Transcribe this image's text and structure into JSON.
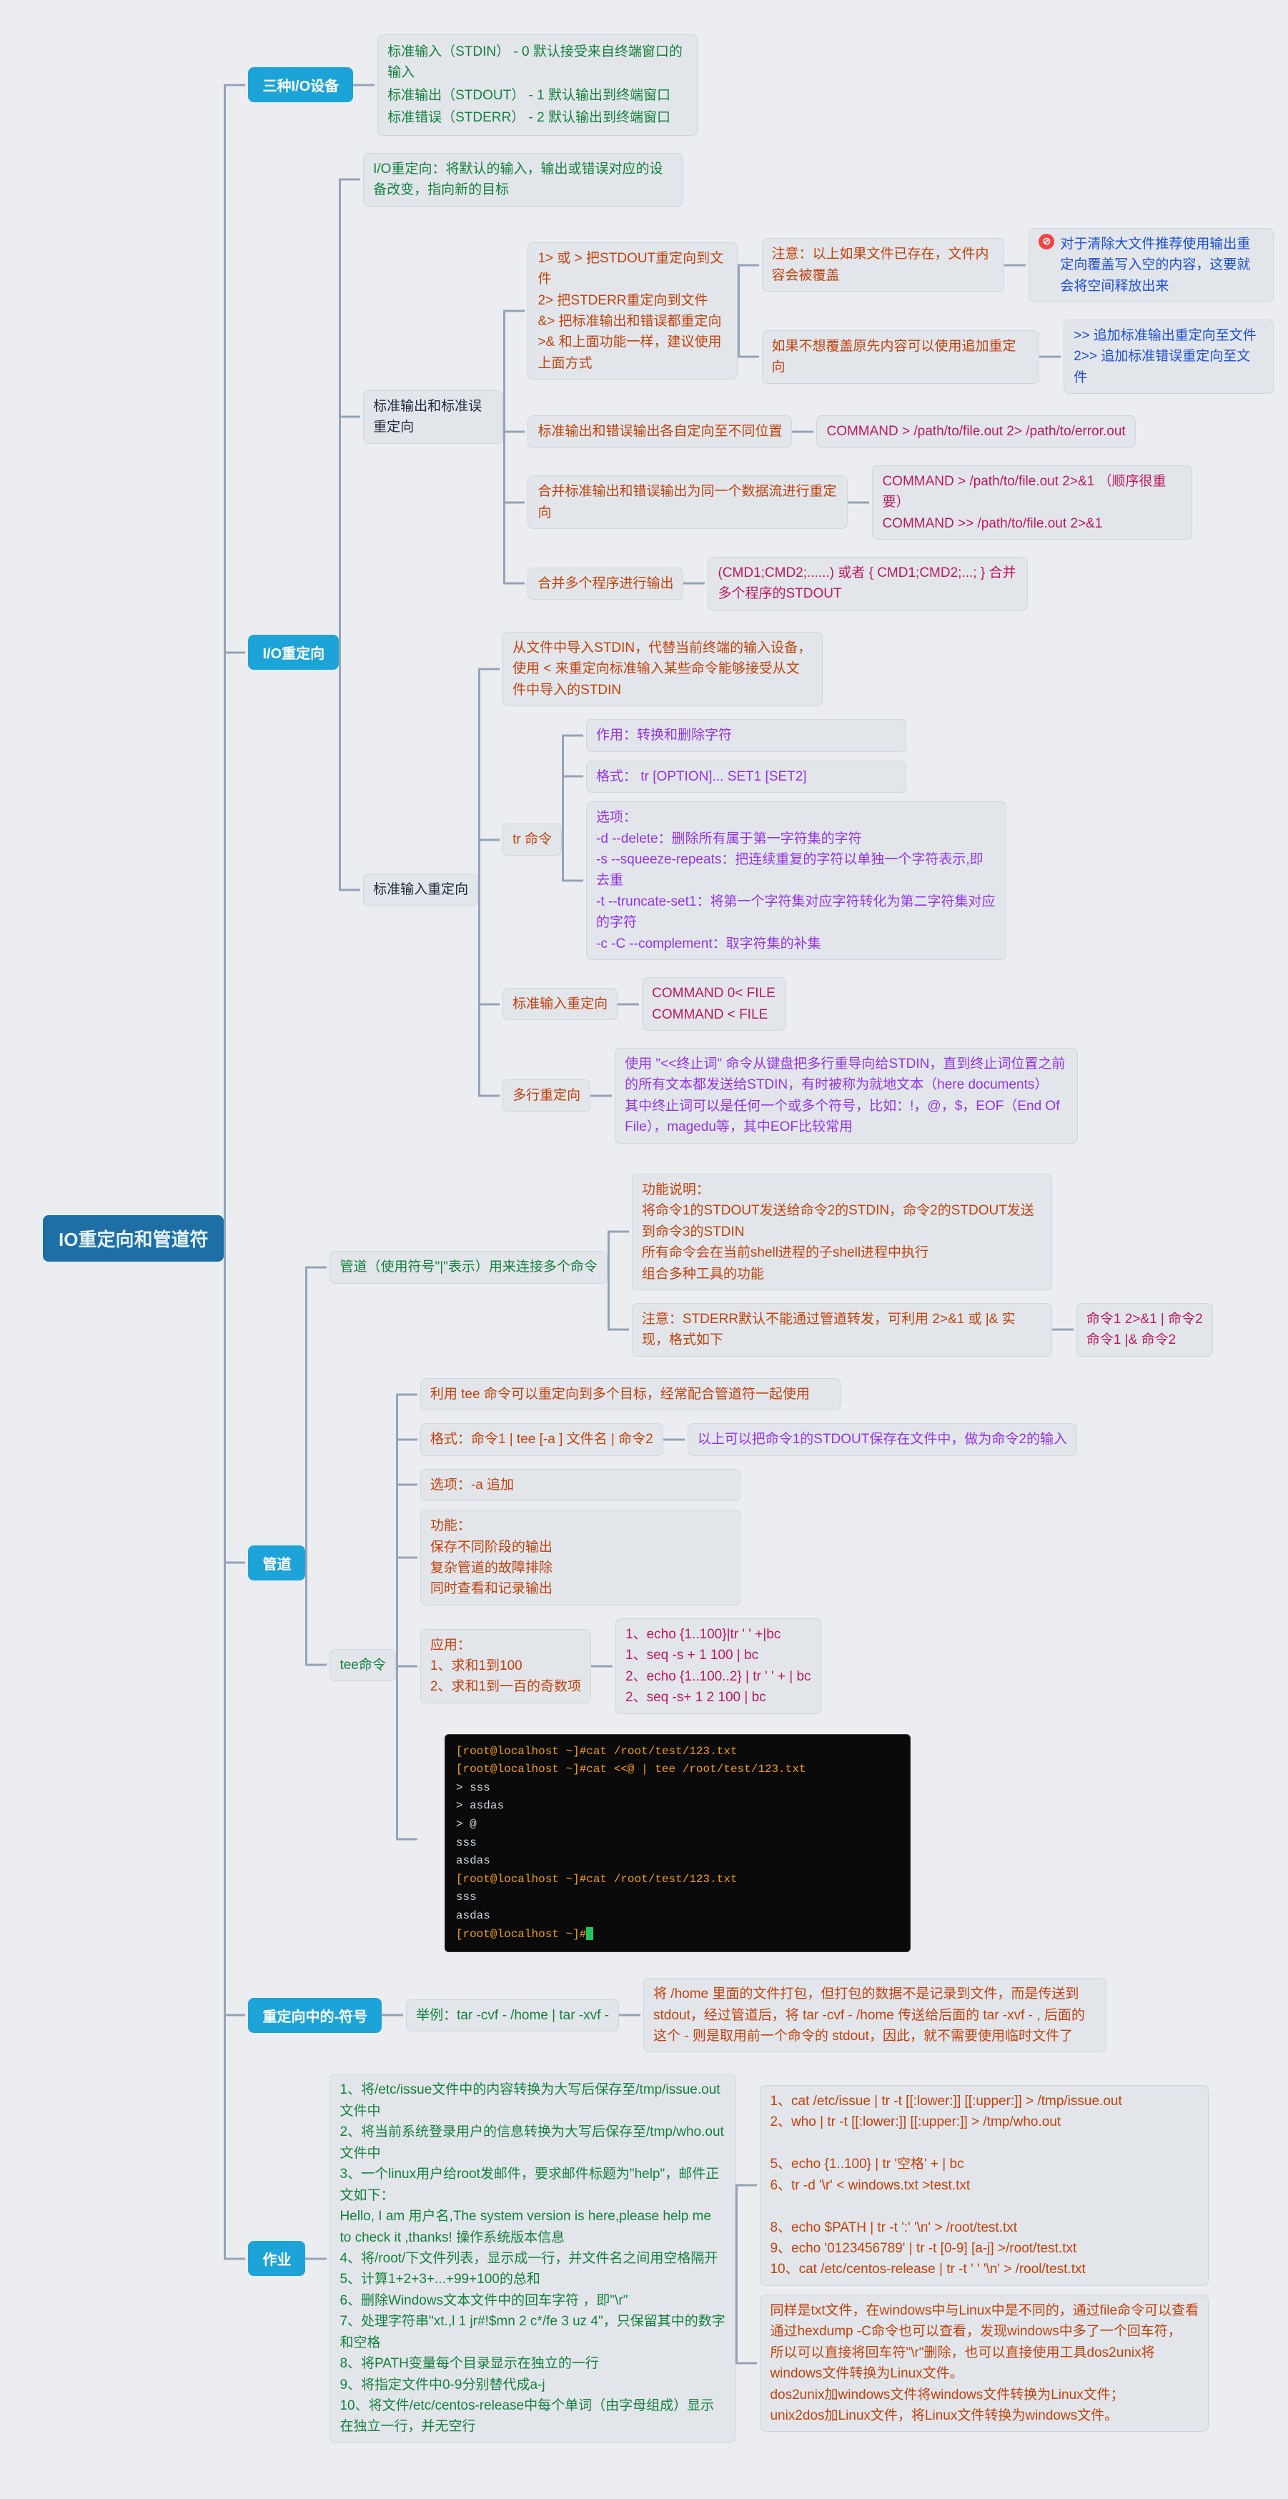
{
  "root": "IO重定向和管道符",
  "b1": {
    "title": "三种I/O设备",
    "stdin": "标准输入（STDIN）  - 0 默认接受来自终端窗口的输入",
    "stdout": "标准输出（STDOUT） - 1 默认输出到终端窗口",
    "stderr": "标准错误（STDERR） - 2 默认输出到终端窗口"
  },
  "b2": {
    "title": "I/O重定向",
    "def": "I/O重定向：将默认的输入，输出或错误对应的设备改变，指向新的目标",
    "out": {
      "title": "标准输出和标准误重定向",
      "rules": "1> 或 >   把STDOUT重定向到文件\n2> 把STDERR重定向到文件\n&> 把标准输出和错误都重定向\n>& 和上面功能一样，建议使用上面方式",
      "warn": "注意：以上如果文件已存在，文件内容会被覆盖",
      "warn_r": "对于清除大文件推荐使用输出重定向覆盖写入空的内容，这要就会将空间释放出来",
      "append": "如果不想覆盖原先内容可以使用追加重定向",
      "append_r": ">> 追加标准输出重定向至文件\n2>> 追加标准错误重定向至文件",
      "sep": "标准输出和错误输出各自定向至不同位置",
      "sep_r": "COMMAND > /path/to/file.out 2> /path/to/error.out",
      "merge": "合并标准输出和错误输出为同一个数据流进行重定向",
      "merge_r": "COMMAND > /path/to/file.out 2>&1   （顺序很重要）\nCOMMAND >> /path/to/file.out 2>&1",
      "multi": "合并多个程序进行输出",
      "multi_r": "(CMD1;CMD2;......) 或者 { CMD1;CMD2;...; } 合并多个程序的STDOUT"
    },
    "in": {
      "title": "标准输入重定向",
      "intro": "从文件中导入STDIN，代替当前终端的输入设备，使用 < 来重定向标准输入某些命令能够接受从文件中导入的STDIN",
      "tr": {
        "title": "tr 命令",
        "use": "作用：转换和删除字符",
        "fmt": "格式： tr [OPTION]... SET1 [SET2]",
        "opts": "选项：\n-d --delete：删除所有属于第一字符集的字符\n-s --squeeze-repeats：把连续重复的字符以单独一个字符表示,即去重\n-t --truncate-set1：将第一个字符集对应字符转化为第二字符集对应的字符\n-c -C --complement：取字符集的补集"
      },
      "redir": "标准输入重定向",
      "redir_r": "COMMAND 0< FILE\nCOMMAND < FILE",
      "heredoc": "多行重定向",
      "heredoc_body": "使用 \"<<终止词\" 命令从键盘把多行重导向给STDIN，直到终止词位置之前的所有文本都发送给STDIN，有时被称为就地文本（here documents）\n其中终止词可以是任何一个或多个符号，比如：!，@，$，EOF（End Of File），magedu等，其中EOF比较常用"
    }
  },
  "b3": {
    "title": "管道",
    "pipe": {
      "title": "管道（使用符号\"|\"表示）用来连接多个命令",
      "desc": "功能说明：\n将命令1的STDOUT发送给命令2的STDIN，命令2的STDOUT发送到命令3的STDIN\n所有命令会在当前shell进程的子shell进程中执行\n组合多种工具的功能",
      "note": "注意：STDERR默认不能通过管道转发，可利用 2>&1 或 |& 实现，格式如下",
      "note_r": "命令1 2>&1 | 命令2\n命令1 |& 命令2"
    },
    "tee": {
      "title": "tee命令",
      "l1": "利用 tee 命令可以重定向到多个目标，经常配合管道符一起使用",
      "l2": "格式：命令1 | tee [-a ] 文件名 | 命令2",
      "l2r": "以上可以把命令1的STDOUT保存在文件中，做为命令2的输入",
      "l3": "选项：-a 追加",
      "l4": "功能：\n保存不同阶段的输出\n复杂管道的故障排除\n同时查看和记录输出",
      "app": "应用：\n1、求和1到100\n2、求和1到一百的奇数项",
      "app_r": "1、echo {1..100}|tr ' ' +|bc\n1、seq -s + 1 100 | bc\n2、echo {1..100..2} | tr ' ' + | bc\n2、seq -s+ 1 2 100 | bc"
    },
    "term": {
      "l1": "[root@localhost ~]#cat /root/test/123.txt",
      "l2": "[root@localhost ~]#cat <<@ | tee /root/test/123.txt",
      "l3": "> sss",
      "l4": "> asdas",
      "l5": "> @",
      "l6": "sss",
      "l7": "asdas",
      "l8": "[root@localhost ~]#cat /root/test/123.txt",
      "l9": "sss",
      "l10": "asdas",
      "l11": "[root@localhost ~]#"
    }
  },
  "b4": {
    "title": "重定向中的-符号",
    "ex": "举例：tar -cvf - /home | tar -xvf -",
    "ex_r": "将 /home 里面的文件打包，但打包的数据不是记录到文件，而是传送到 stdout，经过管道后，将 tar -cvf - /home 传送给后面的 tar -xvf - , 后面的这个 - 则是取用前一个命令的 stdout，因此，就不需要使用临时文件了"
  },
  "b5": {
    "title": "作业",
    "q": "1、将/etc/issue文件中的内容转换为大写后保存至/tmp/issue.out文件中\n2、将当前系统登录用户的信息转换为大写后保存至/tmp/who.out文件中\n3、一个linux用户给root发邮件，要求邮件标题为\"help\"，邮件正文如下：\n    Hello, I am 用户名,The system version is here,please help me to check it ,thanks! 操作系统版本信息\n4、将/root/下文件列表，显示成一行，并文件名之间用空格隔开\n5、计算1+2+3+...+99+100的总和\n6、删除Windows文本文件中的回车字符 ，即\"\\r\"\n7、处理字符串\"xt.,l 1 jr#!$mn 2 c*/fe 3 uz 4\"，只保留其中的数字和空格\n8、将PATH变量每个目录显示在独立的一行\n9、将指定文件中0-9分别替代成a-j\n10、将文件/etc/centos-release中每个单词（由字母组成）显示在独立一行，并无空行",
    "a1": "1、cat /etc/issue | tr -t [[:lower:]] [[:upper:]] > /tmp/issue.out\n2、who | tr -t [[:lower:]] [[:upper:]] > /tmp/who.out\n\n5、echo {1..100} | tr '空格' + | bc\n6、tr -d '\\r' < windows.txt >test.txt\n\n8、echo $PATH | tr -t ':' '\\n' > /root/test.txt\n9、echo '0123456789' | tr -t [0-9] [a-j] >/root/test.txt\n10、cat /etc/centos-release | tr -t ' ' '\\n' > /rool/test.txt",
    "a2": "同样是txt文件，在windows中与Linux中是不同的，通过file命令可以查看通过hexdump -C命令也可以查看，发现windows中多了一个回车符，\n所以可以直接将回车符\"\\r\"删除，也可以直接使用工具dos2unix将windows文件转换为Linux文件。\ndos2unix加windows文件将windows文件转换为Linux文件；\nunix2dos加Linux文件，将Linux文件转换为windows文件。"
  }
}
